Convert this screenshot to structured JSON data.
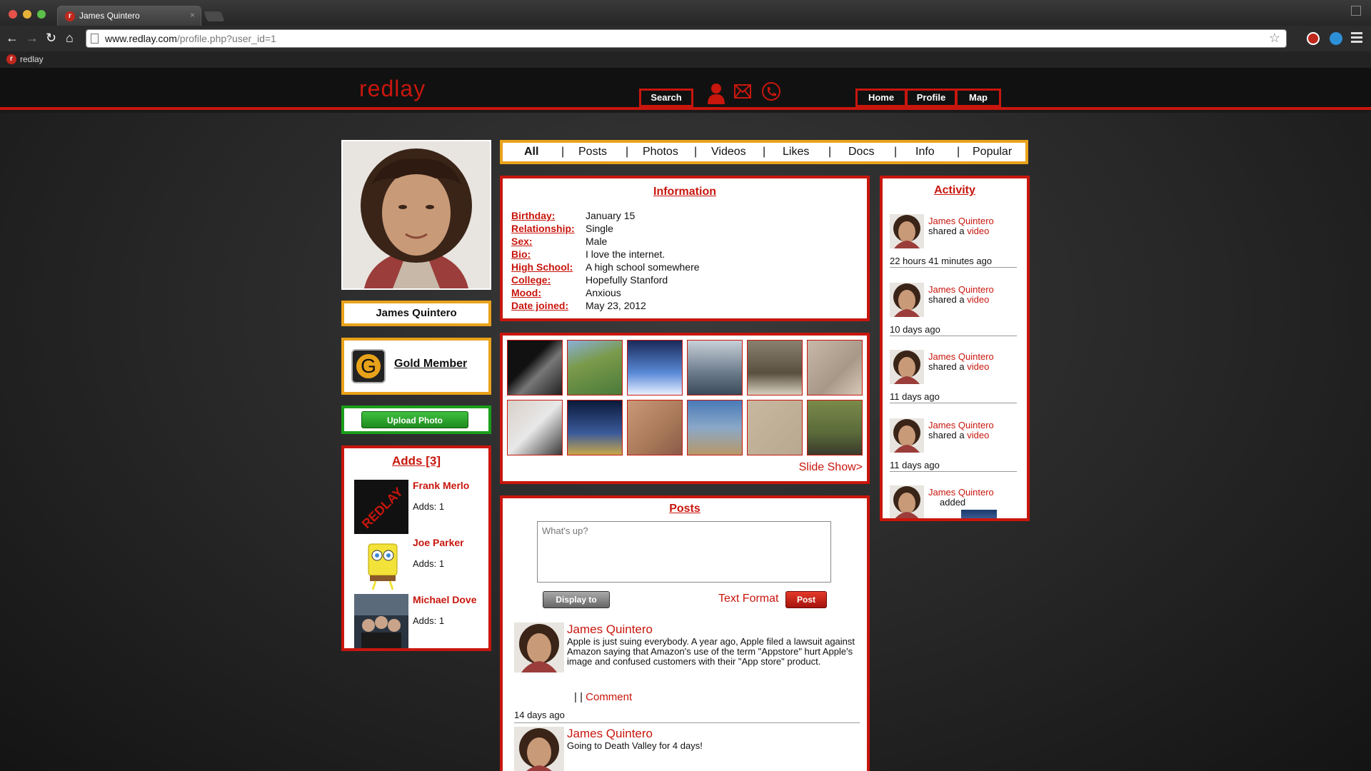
{
  "browser": {
    "tab_title": "James Quintero",
    "tab_close": "×",
    "url_domain": "www.redlay.com",
    "url_path": "/profile.php?user_id=1",
    "bookmark_label": "redlay",
    "favicon_letter": "r"
  },
  "site": {
    "logo": "redlay",
    "nav": {
      "search": "Search",
      "home": "Home",
      "profile": "Profile",
      "map": "Map"
    },
    "accent_color": "#c8160d",
    "gold_color": "#e9a21a",
    "green_color": "#1a9e1a"
  },
  "profile": {
    "name": "James Quintero",
    "membership_badge_letter": "G",
    "membership": "Gold Member",
    "upload_label": "Upload Photo"
  },
  "tabs": [
    "All",
    "Posts",
    "Photos",
    "Videos",
    "Likes",
    "Docs",
    "Info",
    "Popular"
  ],
  "tab_separator": "|",
  "information": {
    "title": "Information",
    "rows": [
      {
        "label": "Birthday:",
        "value": "January 15"
      },
      {
        "label": "Relationship:",
        "value": "Single"
      },
      {
        "label": "Sex:",
        "value": "Male"
      },
      {
        "label": "Bio:",
        "value": "I love the internet."
      },
      {
        "label": "High School:",
        "value": "A high school somewhere"
      },
      {
        "label": "College:",
        "value": "Hopefully Stanford"
      },
      {
        "label": "Mood:",
        "value": "Anxious"
      },
      {
        "label": "Date joined:",
        "value": "May 23, 2012"
      }
    ]
  },
  "photos": {
    "slideshow_label": "Slide Show>"
  },
  "adds": {
    "title": "Adds [3]",
    "items": [
      {
        "name": "Frank Merlo",
        "count": "Adds: 1",
        "thumb_text": "REDLAY"
      },
      {
        "name": "Joe Parker",
        "count": "Adds: 1"
      },
      {
        "name": "Michael Dove",
        "count": "Adds: 1"
      }
    ]
  },
  "posts": {
    "title": "Posts",
    "input_placeholder": "What's up?",
    "display_to_label": "Display to",
    "text_format_label": "Text Format",
    "post_label": "Post",
    "items": [
      {
        "author": "James Quintero",
        "body": "Apple is just suing everybody. A year ago, Apple filed a lawsuit against Amazon saying that Amazon's use of the term \"Appstore\" hurt Apple's image and confused customers with their \"App store\" product.",
        "actions_sep": "| |",
        "comment_label": "Comment",
        "time": "14 days ago"
      },
      {
        "author": "James Quintero",
        "body": "Going to Death Valley for 4 days!"
      }
    ]
  },
  "activity": {
    "title": "Activity",
    "items": [
      {
        "name": "James Quintero",
        "verb": "shared a",
        "object": "video",
        "time": "22 hours 41 minutes ago"
      },
      {
        "name": "James Quintero",
        "verb": "shared a",
        "object": "video",
        "time": "10 days ago"
      },
      {
        "name": "James Quintero",
        "verb": "shared a",
        "object": "video",
        "time": "11 days ago"
      },
      {
        "name": "James Quintero",
        "verb": "shared a",
        "object": "video",
        "time": "11 days ago"
      },
      {
        "name": "James Quintero",
        "verb": "added",
        "object": ""
      }
    ]
  }
}
